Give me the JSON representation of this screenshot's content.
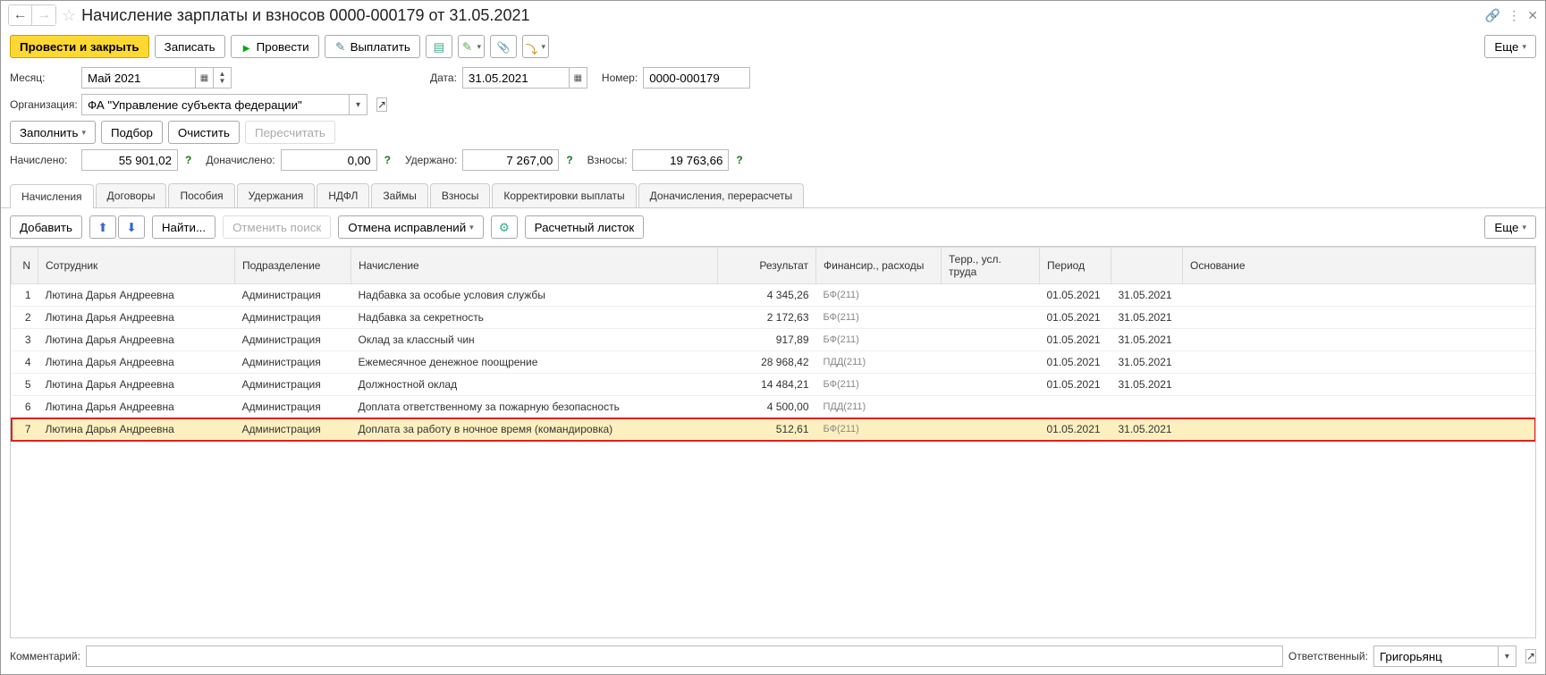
{
  "header": {
    "title": "Начисление зарплаты и взносов 0000-000179 от 31.05.2021"
  },
  "cmd": {
    "post_close": "Провести и закрыть",
    "save": "Записать",
    "post": "Провести",
    "pay": "Выплатить",
    "more": "Еще"
  },
  "form": {
    "month_lbl": "Месяц:",
    "month": "Май 2021",
    "date_lbl": "Дата:",
    "date": "31.05.2021",
    "number_lbl": "Номер:",
    "number": "0000-000179",
    "org_lbl": "Организация:",
    "org": "ФА \"Управление субъекта федерации\"",
    "fill": "Заполнить",
    "pick": "Подбор",
    "clear": "Очистить",
    "recalc": "Пересчитать",
    "accrued_lbl": "Начислено:",
    "accrued": "55 901,02",
    "extra_lbl": "Доначислено:",
    "extra": "0,00",
    "withheld_lbl": "Удержано:",
    "withheld": "7 267,00",
    "contrib_lbl": "Взносы:",
    "contrib": "19 763,66"
  },
  "tabs": [
    "Начисления",
    "Договоры",
    "Пособия",
    "Удержания",
    "НДФЛ",
    "Займы",
    "Взносы",
    "Корректировки выплаты",
    "Доначисления, перерасчеты"
  ],
  "tabtb": {
    "add": "Добавить",
    "find": "Найти...",
    "cancel_search": "Отменить поиск",
    "cancel_fix": "Отмена исправлений",
    "payslip": "Расчетный листок",
    "more": "Еще"
  },
  "cols": [
    "N",
    "Сотрудник",
    "Подразделение",
    "Начисление",
    "Результат",
    "Финансир., расходы",
    "Терр., усл. труда",
    "Период",
    "",
    "Основание"
  ],
  "rows": [
    {
      "n": "1",
      "emp": "Лютина Дарья Андреевна",
      "dep": "Администрация",
      "acc": "Надбавка за особые условия службы",
      "res": "4 345,26",
      "fin": "БФ(211)",
      "terr": "",
      "p1": "01.05.2021",
      "p2": "31.05.2021",
      "basis": ""
    },
    {
      "n": "2",
      "emp": "Лютина Дарья Андреевна",
      "dep": "Администрация",
      "acc": "Надбавка за секретность",
      "res": "2 172,63",
      "fin": "БФ(211)",
      "terr": "",
      "p1": "01.05.2021",
      "p2": "31.05.2021",
      "basis": ""
    },
    {
      "n": "3",
      "emp": "Лютина Дарья Андреевна",
      "dep": "Администрация",
      "acc": "Оклад за классный чин",
      "res": "917,89",
      "fin": "БФ(211)",
      "terr": "",
      "p1": "01.05.2021",
      "p2": "31.05.2021",
      "basis": ""
    },
    {
      "n": "4",
      "emp": "Лютина Дарья Андреевна",
      "dep": "Администрация",
      "acc": "Ежемесячное денежное поощрение",
      "res": "28 968,42",
      "fin": "ПДД(211)",
      "terr": "",
      "p1": "01.05.2021",
      "p2": "31.05.2021",
      "basis": ""
    },
    {
      "n": "5",
      "emp": "Лютина Дарья Андреевна",
      "dep": "Администрация",
      "acc": "Должностной оклад",
      "res": "14 484,21",
      "fin": "БФ(211)",
      "terr": "",
      "p1": "01.05.2021",
      "p2": "31.05.2021",
      "basis": ""
    },
    {
      "n": "6",
      "emp": "Лютина Дарья Андреевна",
      "dep": "Администрация",
      "acc": "Доплата ответственному за пожарную безопасность",
      "res": "4 500,00",
      "fin": "ПДД(211)",
      "terr": "",
      "p1": "",
      "p2": "",
      "basis": ""
    },
    {
      "n": "7",
      "emp": "Лютина Дарья Андреевна",
      "dep": "Администрация",
      "acc": "Доплата за работу в ночное время (командировка)",
      "res": "512,61",
      "fin": "БФ(211)",
      "terr": "",
      "p1": "01.05.2021",
      "p2": "31.05.2021",
      "basis": ""
    }
  ],
  "footer": {
    "comment_lbl": "Комментарий:",
    "comment": "",
    "resp_lbl": "Ответственный:",
    "resp": "Григорьянц"
  }
}
